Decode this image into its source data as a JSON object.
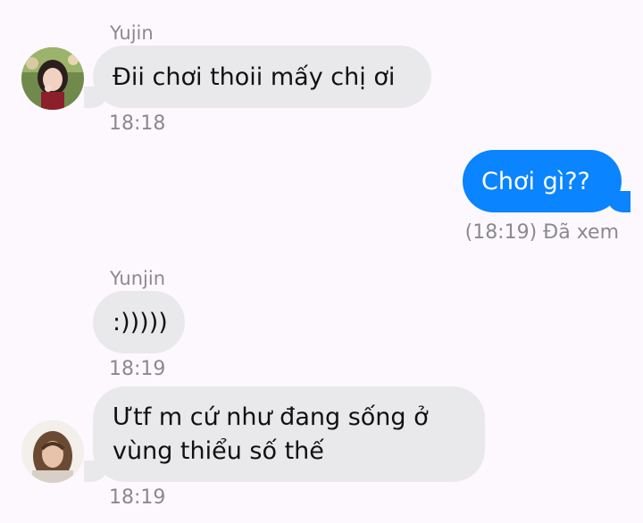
{
  "messages": [
    {
      "sender": "Yujin",
      "text": "Đii chơi thoii mấy chị ơi",
      "time": "18:18"
    },
    {
      "text": "Chơi gì??",
      "status": "(18:19) Đã xem"
    },
    {
      "sender": "Yunjin",
      "text": ":)))))",
      "time": "18:19"
    },
    {
      "text_line1": "Ưtf m cứ như đang sống ở",
      "text_line2": "vùng thiểu số thế",
      "time": "18:19"
    }
  ],
  "colors": {
    "background": "#fdf8fd",
    "incoming_bubble": "#e9e9eb",
    "outgoing_bubble": "#0a84ff",
    "meta_text": "#8a8a8e"
  },
  "icons": {
    "avatar_1": "avatar-photo-yujin",
    "avatar_2": "avatar-photo-yunjin"
  }
}
